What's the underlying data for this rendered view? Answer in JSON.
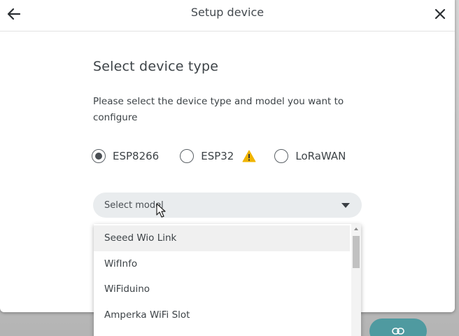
{
  "dialog": {
    "title": "Setup device",
    "back_icon": "arrow-left-icon",
    "close_icon": "close-icon"
  },
  "content": {
    "heading": "Select device type",
    "instructions": "Please select the device type and model you want to configure"
  },
  "device_types": [
    {
      "label": "ESP8266",
      "selected": true
    },
    {
      "label": "ESP32",
      "selected": false,
      "warning_icon": "warning-icon"
    },
    {
      "label": "LoRaWAN",
      "selected": false
    }
  ],
  "model_select": {
    "placeholder": "Select model",
    "caret_icon": "caret-down-icon",
    "open": true
  },
  "model_options": [
    "Seeed Wio Link",
    "WifInfo",
    "WiFiduino",
    "Amperka WiFi Slot"
  ],
  "colors": {
    "accent": "#4f9aa0",
    "warning": "#f0b400",
    "text": "#3d4347",
    "select_bg": "#e9ecee"
  }
}
